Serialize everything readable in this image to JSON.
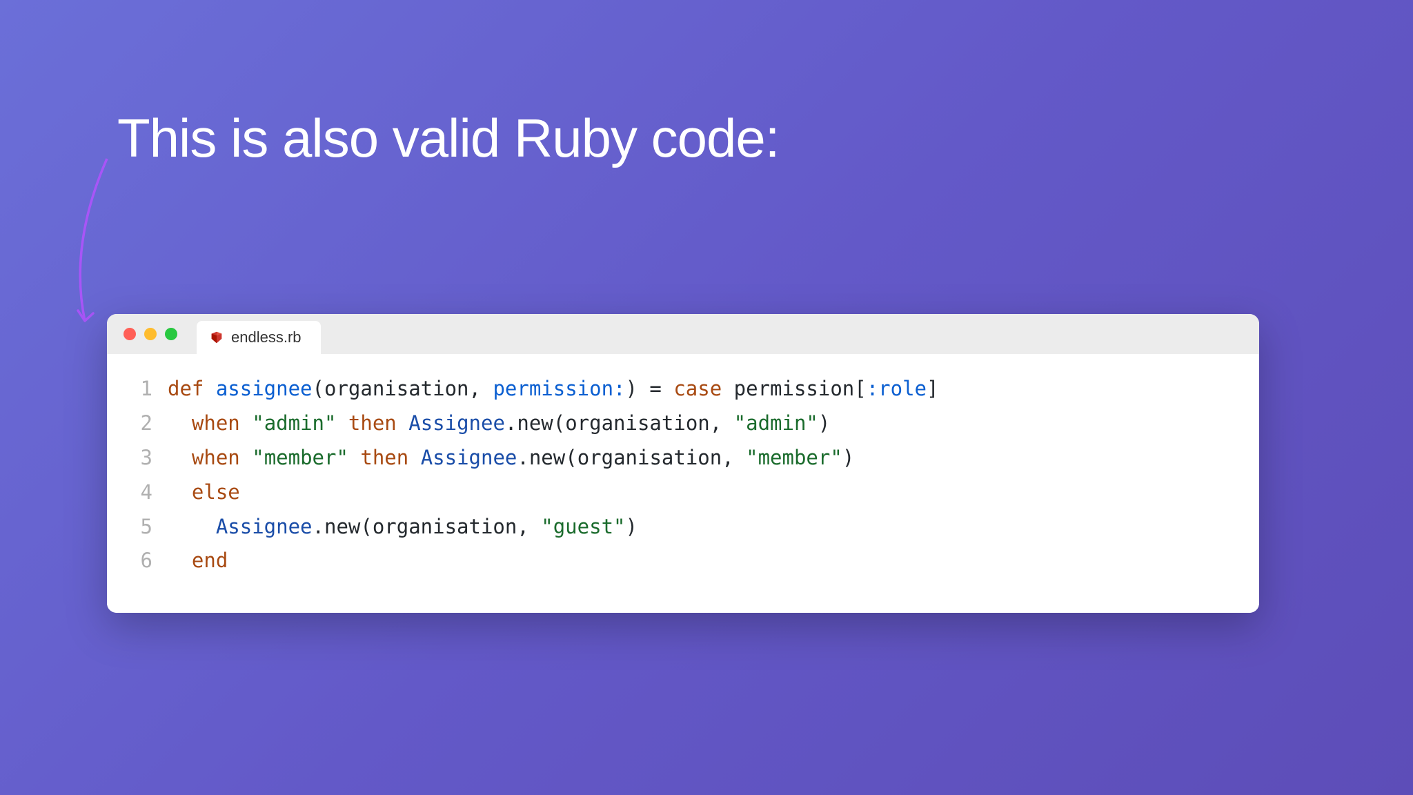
{
  "heading": "This is also valid Ruby code:",
  "tab": {
    "filename": "endless.rb",
    "icon_name": "ruby-icon"
  },
  "traffic_lights": {
    "close": "#ff5f57",
    "minimize": "#febc2e",
    "maximize": "#28c840"
  },
  "code": {
    "lines": [
      {
        "num": "1",
        "tokens": [
          {
            "t": "def ",
            "c": "kw"
          },
          {
            "t": "assignee",
            "c": "fn"
          },
          {
            "t": "(organisation, ",
            "c": "op"
          },
          {
            "t": "permission:",
            "c": "param"
          },
          {
            "t": ") = ",
            "c": "op"
          },
          {
            "t": "case ",
            "c": "kw"
          },
          {
            "t": "permission[",
            "c": "op"
          },
          {
            "t": ":role",
            "c": "sym"
          },
          {
            "t": "]",
            "c": "op"
          }
        ]
      },
      {
        "num": "2",
        "tokens": [
          {
            "t": "  ",
            "c": "op"
          },
          {
            "t": "when ",
            "c": "kw"
          },
          {
            "t": "\"admin\"",
            "c": "str"
          },
          {
            "t": " ",
            "c": "op"
          },
          {
            "t": "then ",
            "c": "kw"
          },
          {
            "t": "Assignee",
            "c": "cls"
          },
          {
            "t": ".new(organisation, ",
            "c": "op"
          },
          {
            "t": "\"admin\"",
            "c": "str"
          },
          {
            "t": ")",
            "c": "op"
          }
        ]
      },
      {
        "num": "3",
        "tokens": [
          {
            "t": "  ",
            "c": "op"
          },
          {
            "t": "when ",
            "c": "kw"
          },
          {
            "t": "\"member\"",
            "c": "str"
          },
          {
            "t": " ",
            "c": "op"
          },
          {
            "t": "then ",
            "c": "kw"
          },
          {
            "t": "Assignee",
            "c": "cls"
          },
          {
            "t": ".new(organisation, ",
            "c": "op"
          },
          {
            "t": "\"member\"",
            "c": "str"
          },
          {
            "t": ")",
            "c": "op"
          }
        ]
      },
      {
        "num": "4",
        "tokens": [
          {
            "t": "  ",
            "c": "op"
          },
          {
            "t": "else",
            "c": "kw"
          }
        ]
      },
      {
        "num": "5",
        "tokens": [
          {
            "t": "    ",
            "c": "op"
          },
          {
            "t": "Assignee",
            "c": "cls"
          },
          {
            "t": ".new(organisation, ",
            "c": "op"
          },
          {
            "t": "\"guest\"",
            "c": "str"
          },
          {
            "t": ")",
            "c": "op"
          }
        ]
      },
      {
        "num": "6",
        "tokens": [
          {
            "t": "  ",
            "c": "op"
          },
          {
            "t": "end",
            "c": "kw"
          }
        ]
      }
    ]
  }
}
